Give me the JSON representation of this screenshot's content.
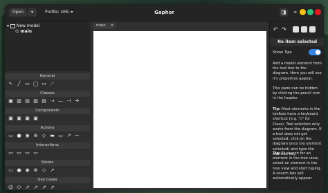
{
  "window": {
    "title": "Gaphor"
  },
  "header": {
    "open_label": "Open",
    "open_chevron": "▾",
    "profile_label": "Profile: UML",
    "profile_chevron": "▾",
    "menu_icon": "≡"
  },
  "window_controls": {
    "colors": [
      "#f5c211",
      "#2ec27e",
      "#e01b24"
    ]
  },
  "model_tree": {
    "root_label": "New model",
    "root_toggle": "▾",
    "child_label": "main"
  },
  "toolbox": {
    "sections": [
      {
        "label": "General",
        "tools": [
          "↖",
          "╱",
          "▭",
          "◯",
          "▭",
          "⟋"
        ]
      },
      {
        "label": "Classes",
        "tools": [
          "▣",
          "▥",
          "▤",
          "▥",
          "▤",
          "⇢",
          "—",
          "⊣",
          "✛"
        ]
      },
      {
        "label": "Components",
        "tools": [
          "▣",
          "▣",
          "▣",
          "▣"
        ]
      },
      {
        "label": "Actions",
        "tools": [
          "▭",
          "●",
          "◉",
          "⊗",
          "◇",
          "▬",
          "▭",
          "↗",
          "⌐"
        ]
      },
      {
        "label": "Interactions",
        "tools": [
          "▭",
          "▭",
          "▭",
          "▭"
        ]
      },
      {
        "label": "States",
        "tools": [
          "▭",
          "●",
          "◉",
          "⊗",
          "◇",
          "↗"
        ]
      },
      {
        "label": "Use Cases",
        "tools": [
          "☺",
          "⬭",
          "↗",
          "↗",
          "↗",
          "↗"
        ]
      }
    ]
  },
  "diagram_tab": {
    "label": "main",
    "close": "×"
  },
  "right_panel": {
    "undo_icon": "↶",
    "redo_icon": "↷",
    "title": "No item selected",
    "show_tips_label": "Show Tips",
    "show_tips_on": true,
    "tips": [
      "Add a model element from the tool box to the diagram. Here you will see it's properties appear.",
      "This pane can be hidden by clicking the pencil icon in the header.",
      "Tip: Most elements in the toolbox have a keyboard shortcut (e.g. \"c\" for Class). Tool selection only works from the diagram. If a tool does not get selected, click on the diagram once (no element selected) and type the shortcut key.",
      "Tip: To search for an element in the tree view, select an element in the tree view and start typing. A search box will automatically appear."
    ]
  }
}
